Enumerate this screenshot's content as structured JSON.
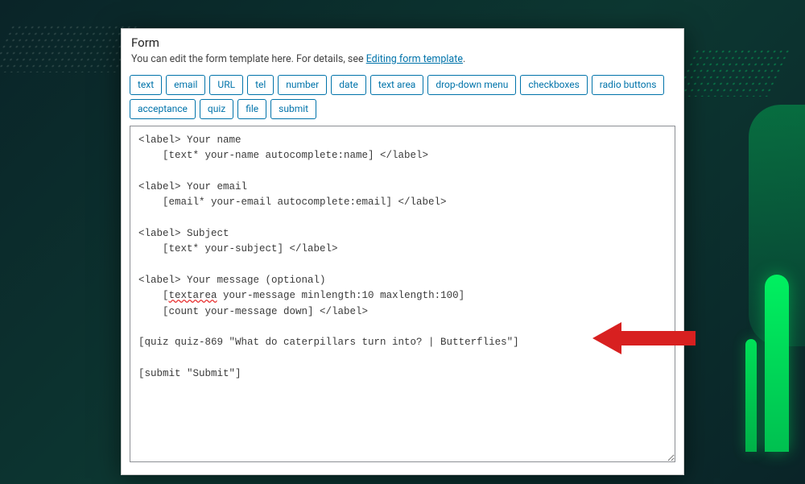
{
  "panel": {
    "title": "Form",
    "desc_prefix": "You can edit the form template here. For details, see ",
    "desc_link": "Editing form template",
    "desc_suffix": "."
  },
  "tags": [
    "text",
    "email",
    "URL",
    "tel",
    "number",
    "date",
    "text area",
    "drop-down menu",
    "checkboxes",
    "radio buttons",
    "acceptance",
    "quiz",
    "file",
    "submit"
  ],
  "code": {
    "l1": "<label> Your name",
    "l2": "    [text* your-name autocomplete:name] </label>",
    "l3": "",
    "l4": "<label> Your email",
    "l5": "    [email* your-email autocomplete:email] </label>",
    "l6": "",
    "l7": "<label> Subject",
    "l8": "    [text* your-subject] </label>",
    "l9": "",
    "l10": "<label> Your message (optional)",
    "l11a": "    [",
    "l11b": "textarea",
    "l11c": " your-message minlength:10 maxlength:100]",
    "l12": "    [count your-message down] </label>",
    "l13": "",
    "l14": "[quiz quiz-869 \"What do caterpillars turn into? | Butterflies\"]",
    "l15": "",
    "l16": "[submit \"Submit\"]"
  }
}
